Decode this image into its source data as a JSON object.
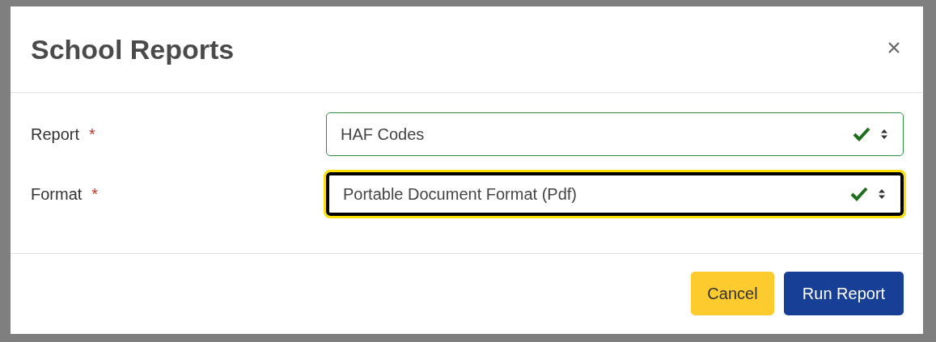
{
  "dialog": {
    "title": "School Reports"
  },
  "fields": [
    {
      "label": "Report",
      "required_mark": "*",
      "value": "HAF Codes",
      "valid": true,
      "focused": false
    },
    {
      "label": "Format",
      "required_mark": "*",
      "value": "Portable Document Format (Pdf)",
      "valid": true,
      "focused": true
    }
  ],
  "buttons": [
    {
      "label": "Cancel",
      "kind": "secondary"
    },
    {
      "label": "Run Report",
      "kind": "primary"
    }
  ]
}
